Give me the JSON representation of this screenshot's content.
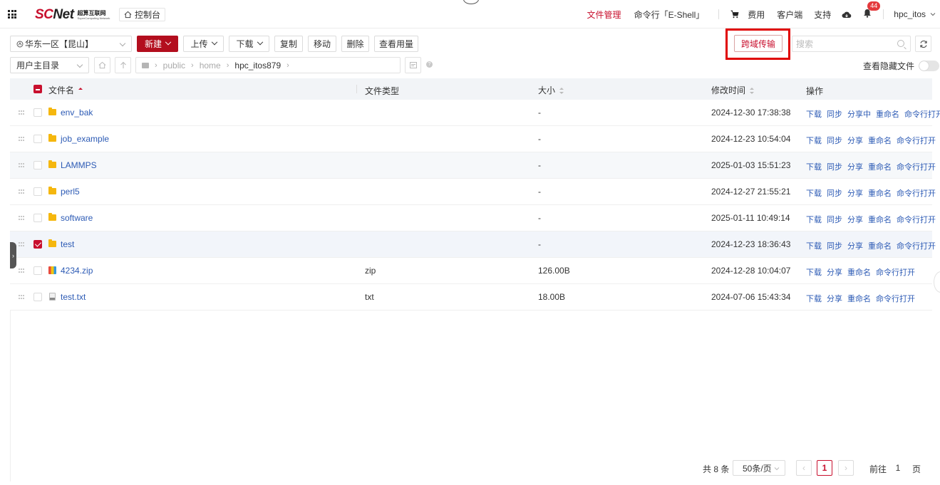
{
  "header": {
    "logo_main": "SCNet",
    "logo_cn": "超算互联网",
    "logo_en": "SuperComputing Network",
    "console_label": "控制台",
    "nav": {
      "file_mgmt": "文件管理",
      "shell": "命令行「E-Shell」",
      "billing": "费用",
      "client": "客户端",
      "support": "支持",
      "notif_count": "44",
      "username": "hpc_itos"
    }
  },
  "toolbar": {
    "region": "华东一区【昆山】",
    "new_label": "新建",
    "upload_label": "上传",
    "download_label": "下载",
    "copy_label": "复制",
    "move_label": "移动",
    "delete_label": "删除",
    "usage_label": "查看用量",
    "cross_transfer_label": "跨域传输",
    "search_placeholder": "搜索"
  },
  "pathbar": {
    "root_select": "用户主目录",
    "crumbs": [
      "public",
      "home",
      "hpc_itos879"
    ],
    "show_hidden_label": "查看隐藏文件"
  },
  "table": {
    "columns": {
      "name": "文件名",
      "type": "文件类型",
      "size": "大小",
      "mtime": "修改时间",
      "ops": "操作"
    },
    "rows": [
      {
        "name": "env_bak",
        "type": "",
        "size": "-",
        "mtime": "2024-12-30 17:38:38",
        "ops": [
          "下载",
          "同步",
          "分享中",
          "重命名",
          "命令行打开"
        ]
      },
      {
        "name": "job_example",
        "type": "",
        "size": "-",
        "mtime": "2024-12-23 10:54:04",
        "ops": [
          "下载",
          "同步",
          "分享",
          "重命名",
          "命令行打开"
        ]
      },
      {
        "name": "LAMMPS",
        "type": "",
        "size": "-",
        "mtime": "2025-01-03 15:51:23",
        "ops": [
          "下载",
          "同步",
          "分享",
          "重命名",
          "命令行打开"
        ]
      },
      {
        "name": "perl5",
        "type": "",
        "size": "-",
        "mtime": "2024-12-27 21:55:21",
        "ops": [
          "下载",
          "同步",
          "分享",
          "重命名",
          "命令行打开"
        ]
      },
      {
        "name": "software",
        "type": "",
        "size": "-",
        "mtime": "2025-01-11 10:49:14",
        "ops": [
          "下载",
          "同步",
          "分享",
          "重命名",
          "命令行打开"
        ]
      },
      {
        "name": "test",
        "type": "",
        "size": "-",
        "mtime": "2024-12-23 18:36:43",
        "ops": [
          "下载",
          "同步",
          "分享",
          "重命名",
          "命令行打开"
        ]
      },
      {
        "name": "4234.zip",
        "type": "zip",
        "size": "126.00B",
        "mtime": "2024-12-28 10:04:07",
        "ops": [
          "下载",
          "分享",
          "重命名",
          "命令行打开"
        ]
      },
      {
        "name": "test.txt",
        "type": "txt",
        "size": "18.00B",
        "mtime": "2024-07-06 15:43:34",
        "ops": [
          "下载",
          "分享",
          "重命名",
          "命令行打开"
        ]
      }
    ]
  },
  "pagination": {
    "total": "共 8 条",
    "page_size": "50条/页",
    "current_page": "1",
    "goto_label": "前往",
    "goto_value": "1",
    "page_suffix": "页"
  }
}
